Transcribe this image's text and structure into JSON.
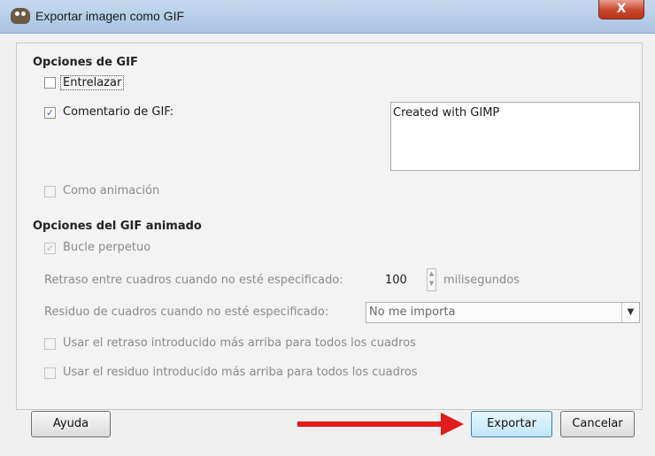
{
  "window": {
    "title": "Exportar imagen como GIF",
    "close_glyph": "X"
  },
  "gif_options": {
    "title": "Opciones de GIF",
    "interlace": {
      "label": "Entrelazar",
      "checked": false
    },
    "comment": {
      "label": "Comentario de GIF:",
      "checked": true,
      "value": "Created with GIMP"
    },
    "as_animation": {
      "label": "Como animación",
      "checked": false,
      "enabled": false
    }
  },
  "animated_options": {
    "title": "Opciones del GIF animado",
    "loop": {
      "label": "Bucle perpetuo",
      "checked": true,
      "enabled": false
    },
    "delay": {
      "label": "Retraso entre cuadros cuando no esté especificado:",
      "value": "100",
      "unit": "milisegundos"
    },
    "disposal": {
      "label": "Residuo de cuadros cuando no esté especificado:",
      "selected": "No me importa"
    },
    "use_delay": {
      "label": "Usar el retraso introducido más arriba para todos los cuadros",
      "checked": false
    },
    "use_disposal": {
      "label": "Usar el residuo introducido más arriba para todos los cuadros",
      "checked": false
    }
  },
  "buttons": {
    "help": "Ayuda",
    "export": "Exportar",
    "cancel": "Cancelar"
  },
  "colors": {
    "accent_arrow": "#e21b1b",
    "titlebar": "#b9cfe9",
    "close": "#c9462f"
  },
  "icons": {
    "app": "gimp-icon",
    "check": "✓",
    "dropdown": "▼"
  }
}
